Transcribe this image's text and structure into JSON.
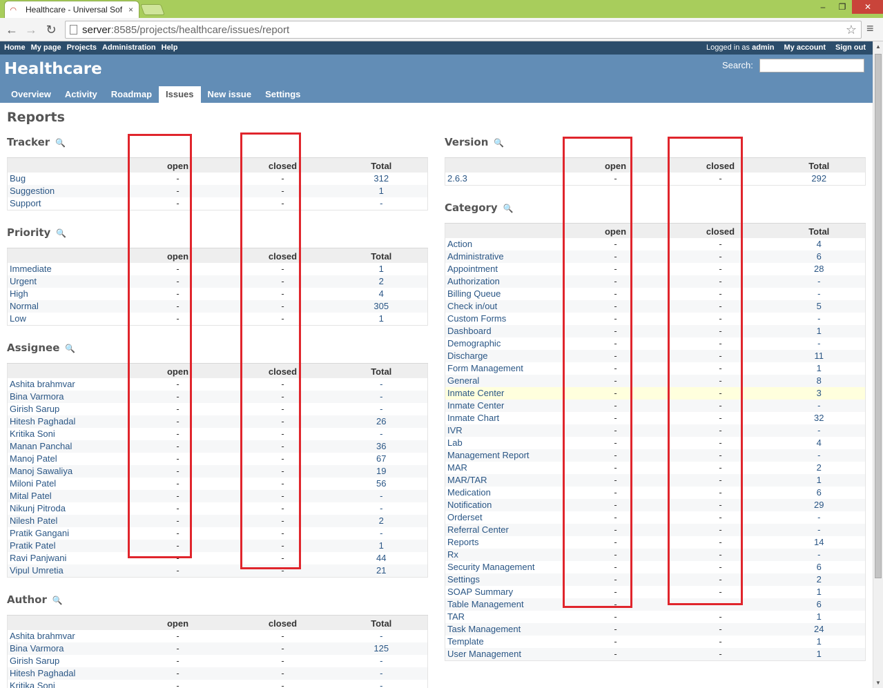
{
  "browser": {
    "tab_title": "Healthcare - Universal Sof",
    "url_host": "server",
    "url_path": ":8585/projects/healthcare/issues/report",
    "tab_close": "×",
    "win_min": "–",
    "win_max": "❐",
    "win_close": "✕"
  },
  "top_menu": {
    "items": [
      "Home",
      "My page",
      "Projects",
      "Administration",
      "Help"
    ],
    "logged_in_as": "Logged in as",
    "user": "admin",
    "my_account": "My account",
    "sign_out": "Sign out"
  },
  "header": {
    "title": "Healthcare",
    "search_label": "Search:"
  },
  "main_menu": {
    "tabs": [
      "Overview",
      "Activity",
      "Roadmap",
      "Issues",
      "New issue",
      "Settings"
    ],
    "selected": "Issues"
  },
  "page_title": "Reports",
  "columns": {
    "open": "open",
    "closed": "closed",
    "total": "Total"
  },
  "sections": {
    "tracker": {
      "title": "Tracker",
      "rows": [
        {
          "name": "Bug",
          "open": "-",
          "closed": "-",
          "total": "312"
        },
        {
          "name": "Suggestion",
          "open": "-",
          "closed": "-",
          "total": "1"
        },
        {
          "name": "Support",
          "open": "-",
          "closed": "-",
          "total": "-"
        }
      ]
    },
    "priority": {
      "title": "Priority",
      "rows": [
        {
          "name": "Immediate",
          "open": "-",
          "closed": "-",
          "total": "1"
        },
        {
          "name": "Urgent",
          "open": "-",
          "closed": "-",
          "total": "2"
        },
        {
          "name": "High",
          "open": "-",
          "closed": "-",
          "total": "4"
        },
        {
          "name": "Normal",
          "open": "-",
          "closed": "-",
          "total": "305"
        },
        {
          "name": "Low",
          "open": "-",
          "closed": "-",
          "total": "1"
        }
      ]
    },
    "assignee": {
      "title": "Assignee",
      "rows": [
        {
          "name": "Ashita brahmvar",
          "open": "-",
          "closed": "-",
          "total": "-"
        },
        {
          "name": "Bina Varmora",
          "open": "-",
          "closed": "-",
          "total": "-"
        },
        {
          "name": "Girish Sarup",
          "open": "-",
          "closed": "-",
          "total": "-"
        },
        {
          "name": "Hitesh Paghadal",
          "open": "-",
          "closed": "-",
          "total": "26"
        },
        {
          "name": "Kritika Soni",
          "open": "-",
          "closed": "-",
          "total": "-"
        },
        {
          "name": "Manan Panchal",
          "open": "-",
          "closed": "-",
          "total": "36"
        },
        {
          "name": "Manoj Patel",
          "open": "-",
          "closed": "-",
          "total": "67"
        },
        {
          "name": "Manoj Sawaliya",
          "open": "-",
          "closed": "-",
          "total": "19"
        },
        {
          "name": "Miloni Patel",
          "open": "-",
          "closed": "-",
          "total": "56"
        },
        {
          "name": "Mital Patel",
          "open": "-",
          "closed": "-",
          "total": "-"
        },
        {
          "name": "Nikunj Pitroda",
          "open": "-",
          "closed": "-",
          "total": "-"
        },
        {
          "name": "Nilesh Patel",
          "open": "-",
          "closed": "-",
          "total": "2"
        },
        {
          "name": "Pratik Gangani",
          "open": "-",
          "closed": "-",
          "total": "-"
        },
        {
          "name": "Pratik Patel",
          "open": "-",
          "closed": "-",
          "total": "1"
        },
        {
          "name": "Ravi Panjwani",
          "open": "-",
          "closed": "-",
          "total": "44"
        },
        {
          "name": "Vipul Umretia",
          "open": "-",
          "closed": "-",
          "total": "21"
        }
      ]
    },
    "author": {
      "title": "Author",
      "rows": [
        {
          "name": "Ashita brahmvar",
          "open": "-",
          "closed": "-",
          "total": "-"
        },
        {
          "name": "Bina Varmora",
          "open": "-",
          "closed": "-",
          "total": "125"
        },
        {
          "name": "Girish Sarup",
          "open": "-",
          "closed": "-",
          "total": "-"
        },
        {
          "name": "Hitesh Paghadal",
          "open": "-",
          "closed": "-",
          "total": "-"
        },
        {
          "name": "Kritika Soni",
          "open": "-",
          "closed": "-",
          "total": "-"
        }
      ]
    },
    "version": {
      "title": "Version",
      "rows": [
        {
          "name": "2.6.3",
          "open": "-",
          "closed": "-",
          "total": "292"
        }
      ]
    },
    "category": {
      "title": "Category",
      "highlight_index": 12,
      "rows": [
        {
          "name": "Action",
          "open": "-",
          "closed": "-",
          "total": "4"
        },
        {
          "name": "Administrative",
          "open": "-",
          "closed": "-",
          "total": "6"
        },
        {
          "name": "Appointment",
          "open": "-",
          "closed": "-",
          "total": "28"
        },
        {
          "name": "Authorization",
          "open": "-",
          "closed": "-",
          "total": "-"
        },
        {
          "name": "Billing Queue",
          "open": "-",
          "closed": "-",
          "total": "-"
        },
        {
          "name": "Check in/out",
          "open": "-",
          "closed": "-",
          "total": "5"
        },
        {
          "name": "Custom Forms",
          "open": "-",
          "closed": "-",
          "total": "-"
        },
        {
          "name": "Dashboard",
          "open": "-",
          "closed": "-",
          "total": "1"
        },
        {
          "name": "Demographic",
          "open": "-",
          "closed": "-",
          "total": "-"
        },
        {
          "name": "Discharge",
          "open": "-",
          "closed": "-",
          "total": "11"
        },
        {
          "name": "Form Management",
          "open": "-",
          "closed": "-",
          "total": "1"
        },
        {
          "name": "General",
          "open": "-",
          "closed": "-",
          "total": "8"
        },
        {
          "name": "Inmate Center",
          "open": "-",
          "closed": "-",
          "total": "3"
        },
        {
          "name": "Inmate Center",
          "open": "-",
          "closed": "-",
          "total": "-"
        },
        {
          "name": "Inmate Chart",
          "open": "-",
          "closed": "-",
          "total": "32"
        },
        {
          "name": "IVR",
          "open": "-",
          "closed": "-",
          "total": "-"
        },
        {
          "name": "Lab",
          "open": "-",
          "closed": "-",
          "total": "4"
        },
        {
          "name": "Management Report",
          "open": "-",
          "closed": "-",
          "total": "-"
        },
        {
          "name": "MAR",
          "open": "-",
          "closed": "-",
          "total": "2"
        },
        {
          "name": "MAR/TAR",
          "open": "-",
          "closed": "-",
          "total": "1"
        },
        {
          "name": "Medication",
          "open": "-",
          "closed": "-",
          "total": "6"
        },
        {
          "name": "Notification",
          "open": "-",
          "closed": "-",
          "total": "29"
        },
        {
          "name": "Orderset",
          "open": "-",
          "closed": "-",
          "total": "-"
        },
        {
          "name": "Referral Center",
          "open": "-",
          "closed": "-",
          "total": "-"
        },
        {
          "name": "Reports",
          "open": "-",
          "closed": "-",
          "total": "14"
        },
        {
          "name": "Rx",
          "open": "-",
          "closed": "-",
          "total": "-"
        },
        {
          "name": "Security Management",
          "open": "-",
          "closed": "-",
          "total": "6"
        },
        {
          "name": "Settings",
          "open": "-",
          "closed": "-",
          "total": "2"
        },
        {
          "name": "SOAP Summary",
          "open": "-",
          "closed": "-",
          "total": "1"
        },
        {
          "name": "Table Management",
          "open": "-",
          "closed": "-",
          "total": "6"
        },
        {
          "name": "TAR",
          "open": "-",
          "closed": "-",
          "total": "1"
        },
        {
          "name": "Task Management",
          "open": "-",
          "closed": "-",
          "total": "24"
        },
        {
          "name": "Template",
          "open": "-",
          "closed": "-",
          "total": "1"
        },
        {
          "name": "User Management",
          "open": "-",
          "closed": "-",
          "total": "1"
        }
      ]
    }
  },
  "colors": {
    "header_bg": "#628db6",
    "top_menu_bg": "#2c4d6b",
    "link": "#2a5685",
    "annotation_red": "#e0252c",
    "chrome_frame": "#a8cd5c"
  }
}
